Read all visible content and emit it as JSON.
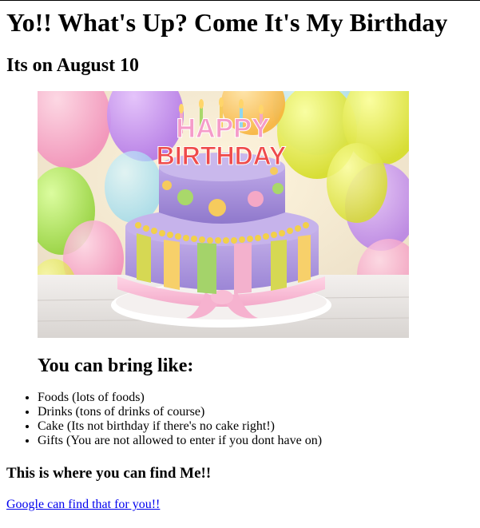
{
  "page": {
    "title": "Yo!! What's Up? Come It's My Birthday",
    "subtitle": "Its on August 10"
  },
  "hero_image": {
    "icon": "birthday-cake-image",
    "cake_text_line1": "HAPPY",
    "cake_text_line2": "BIRTHDAY"
  },
  "bring": {
    "heading": "You can bring like:",
    "items": [
      "Foods (lots of foods)",
      "Drinks (tons of drinks of course)",
      "Cake (Its not birthday if there's no cake right!)",
      "Gifts (You are not allowed to enter if you dont have on)"
    ]
  },
  "find": {
    "heading": "This is where you can find Me!!",
    "link_text": "Google can find that for you!!"
  }
}
